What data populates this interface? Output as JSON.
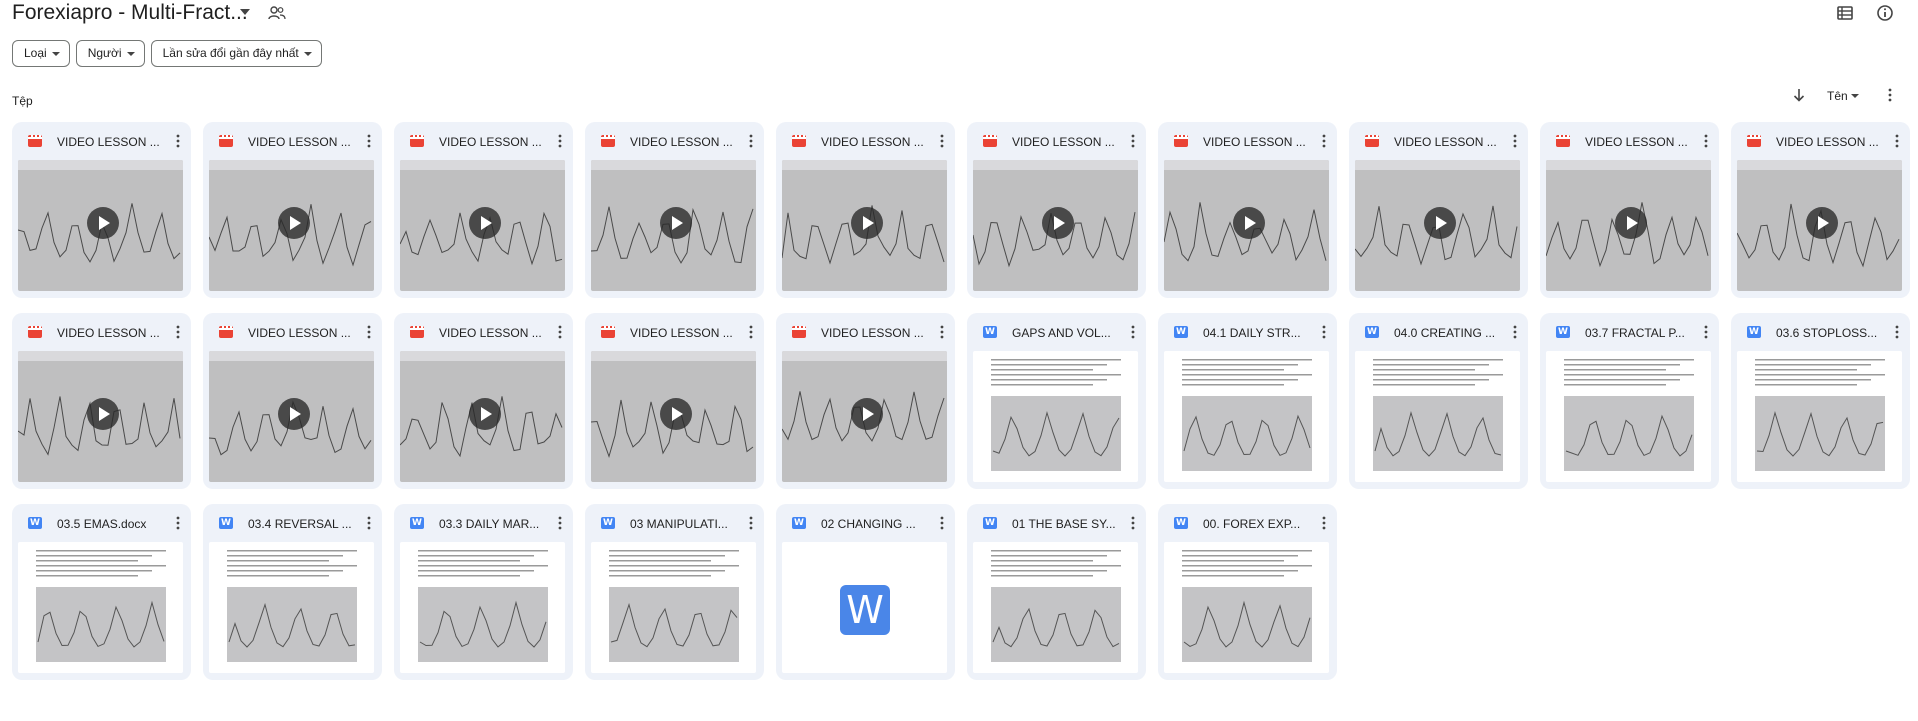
{
  "header": {
    "title": "Forexiapro - Multi-Fract...",
    "icons": [
      "caret-down-icon",
      "shared-folder-icon",
      "list-view-icon",
      "info-icon"
    ]
  },
  "filters": [
    {
      "label": "Loại"
    },
    {
      "label": "Người"
    },
    {
      "label": "Lần sửa đổi gần đây nhất"
    }
  ],
  "section": {
    "label": "Tệp",
    "sort_label": "Tên"
  },
  "colors": {
    "video_icon": "#ea4335",
    "doc_icon": "#4285f4",
    "card_bg": "#eef2f9"
  },
  "files": [
    {
      "name": "VIDEO LESSON ...",
      "type": "video",
      "icon": "video-icon"
    },
    {
      "name": "VIDEO LESSON ...",
      "type": "video",
      "icon": "video-icon"
    },
    {
      "name": "VIDEO LESSON ...",
      "type": "video",
      "icon": "video-icon"
    },
    {
      "name": "VIDEO LESSON ...",
      "type": "video",
      "icon": "video-icon"
    },
    {
      "name": "VIDEO LESSON ...",
      "type": "video",
      "icon": "video-icon"
    },
    {
      "name": "VIDEO LESSON ...",
      "type": "video",
      "icon": "video-icon"
    },
    {
      "name": "VIDEO LESSON ...",
      "type": "video",
      "icon": "video-icon"
    },
    {
      "name": "VIDEO LESSON ...",
      "type": "video",
      "icon": "video-icon"
    },
    {
      "name": "VIDEO LESSON ...",
      "type": "video",
      "icon": "video-icon"
    },
    {
      "name": "VIDEO LESSON ...",
      "type": "video",
      "icon": "video-icon"
    },
    {
      "name": "VIDEO LESSON ...",
      "type": "video",
      "icon": "video-icon"
    },
    {
      "name": "VIDEO LESSON ...",
      "type": "video",
      "icon": "video-icon"
    },
    {
      "name": "VIDEO LESSON ...",
      "type": "video",
      "icon": "video-icon"
    },
    {
      "name": "VIDEO LESSON ...",
      "type": "video",
      "icon": "video-icon"
    },
    {
      "name": "VIDEO LESSON ...",
      "type": "video",
      "icon": "video-icon"
    },
    {
      "name": "GAPS AND VOL...",
      "type": "doc",
      "icon": "word-doc-icon"
    },
    {
      "name": "04.1 DAILY STR...",
      "type": "doc",
      "icon": "word-doc-icon"
    },
    {
      "name": "04.0 CREATING ...",
      "type": "doc",
      "icon": "word-doc-icon"
    },
    {
      "name": "03.7 FRACTAL P...",
      "type": "doc",
      "icon": "word-doc-icon"
    },
    {
      "name": "03.6 STOPLOSS...",
      "type": "doc",
      "icon": "word-doc-icon"
    },
    {
      "name": "03.5 EMAS.docx",
      "type": "doc",
      "icon": "word-doc-icon"
    },
    {
      "name": "03.4 REVERSAL ...",
      "type": "doc",
      "icon": "word-doc-icon"
    },
    {
      "name": "03.3 DAILY MAR...",
      "type": "doc",
      "icon": "word-doc-icon"
    },
    {
      "name": "03 MANIPULATI...",
      "type": "doc",
      "icon": "word-doc-icon"
    },
    {
      "name": "02 CHANGING ...",
      "type": "doc",
      "icon": "word-doc-icon"
    },
    {
      "name": "01 THE BASE SY...",
      "type": "doc",
      "icon": "word-doc-icon"
    },
    {
      "name": "00. FOREX EXP...",
      "type": "doc",
      "icon": "word-doc-icon"
    }
  ],
  "word_tile_letter": "W"
}
